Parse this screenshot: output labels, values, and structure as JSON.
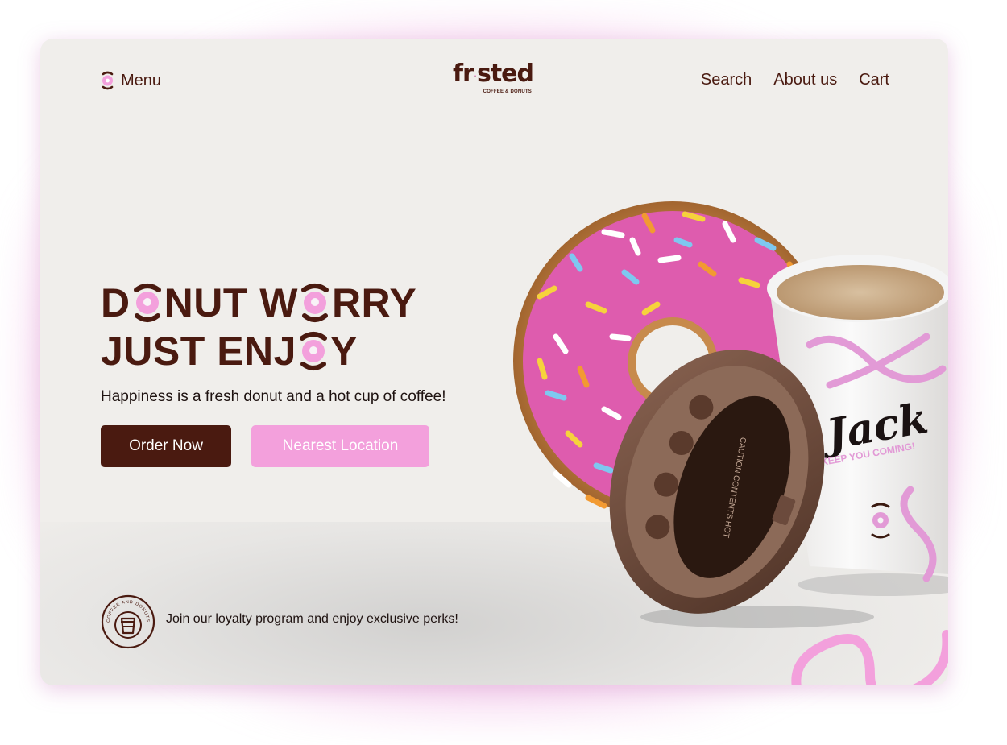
{
  "nav": {
    "menu_label": "Menu",
    "links": [
      "Search",
      "About us",
      "Cart"
    ]
  },
  "logo": {
    "wordmark_start": "fr",
    "wordmark_end": "sted",
    "tagline": "COFFEE & DONUTS"
  },
  "hero": {
    "line1": {
      "a": "D",
      "b": "NUT W",
      "c": "RRY"
    },
    "line2": {
      "a": "JUST ENJ",
      "b": "Y"
    },
    "subtitle": "Happiness is a fresh donut and a hot cup of coffee!",
    "order_button": "Order Now",
    "location_button": "Nearest Location"
  },
  "cup": {
    "name": "Jack",
    "slogan": "KEEP YOU COMING!",
    "lid_text": "CAUTION CONTENTS HOT"
  },
  "loyalty": {
    "badge_text": "COFFEE AND DONUTS",
    "text": "Join our loyalty program and enjoy exclusive perks!"
  },
  "colors": {
    "brand_brown": "#4a1a10",
    "brand_pink": "#f3a0dc",
    "background": "#f0eeeb"
  }
}
